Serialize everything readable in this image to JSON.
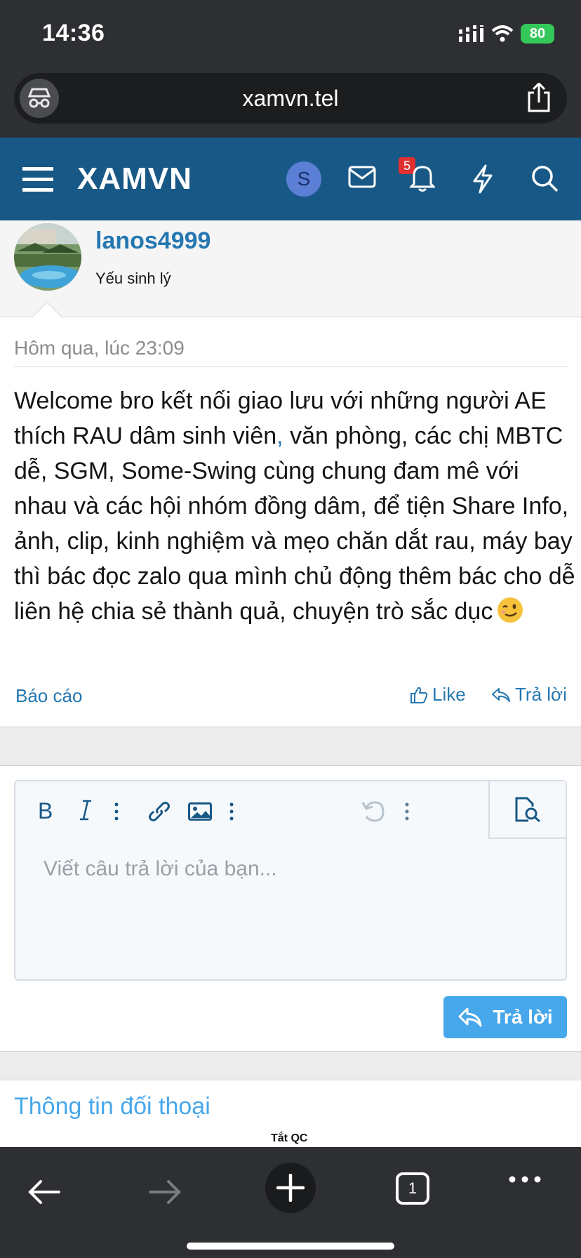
{
  "status_bar": {
    "time": "14:36",
    "battery": "80"
  },
  "browser": {
    "url": "xamvn.tel",
    "tab_count": "1"
  },
  "site": {
    "logo": "XAMVN",
    "avatar_letter": "S",
    "notification_count": "5"
  },
  "post": {
    "username": "lanos4999",
    "user_title": "Yếu sinh lý",
    "date": "Hôm qua, lúc 23:09",
    "body_a": "Welcome bro kết nối giao lưu với những người AE thích RAU dâm sinh viên",
    "body_comma": ",",
    "body_b": " văn phòng, các chị MBTC dễ, SGM, Some-Swing cùng chung đam mê với nhau và các hội nhóm đồng dâm, để tiện Share Info, ảnh, clip, kinh nghiệm và mẹo chăn dắt rau, máy bay thì bác đọc zalo qua mình chủ động thêm bác cho dễ liên hệ chia sẻ thành quả, chuyện trò sắc dục",
    "report_label": "Báo cáo",
    "like_label": "Like",
    "reply_label": "Trả lời"
  },
  "editor": {
    "placeholder": "Viết câu trả lời của bạn...",
    "submit_label": "Trả lời"
  },
  "thread_info": {
    "title": "Thông tin đối thoại",
    "ad_label": "Tắt QC"
  },
  "colors": {
    "header": "#185886",
    "link": "#2577b1",
    "accent": "#47a7eb",
    "browser_chrome": "#2d2f32"
  }
}
